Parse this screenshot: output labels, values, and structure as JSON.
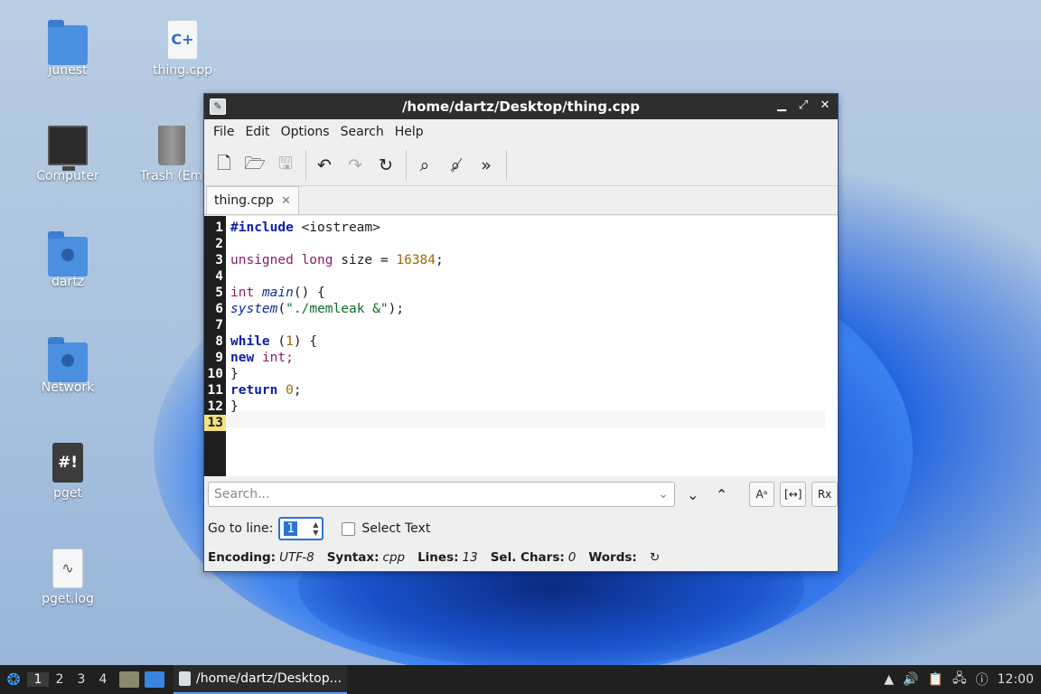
{
  "desktop": {
    "icons": [
      {
        "label": "junest"
      },
      {
        "label": "thing.cpp"
      },
      {
        "label": "Computer"
      },
      {
        "label": "Trash (Em"
      },
      {
        "label": "dartz"
      },
      {
        "label": "Network"
      },
      {
        "label": "pget"
      },
      {
        "label": "pget.log"
      }
    ]
  },
  "window": {
    "title": "/home/dartz/Desktop/thing.cpp",
    "menu": [
      "File",
      "Edit",
      "Options",
      "Search",
      "Help"
    ],
    "tab": {
      "label": "thing.cpp",
      "close": "✕"
    },
    "line_numbers": [
      "1",
      "2",
      "3",
      "4",
      "5",
      "6",
      "7",
      "8",
      "9",
      "10",
      "11",
      "12",
      "13"
    ],
    "current_line": "13",
    "code": {
      "l1a": "#include",
      "l1b": " <iostream>",
      "l3a": "unsigned long",
      "l3b": " size = ",
      "l3c": "16384",
      "l3d": ";",
      "l5a": "int",
      "l5b": " ",
      "l5c": "main",
      "l5d": "() {",
      "l6a": "system",
      "l6b": "(",
      "l6c": "\"./memleak &\"",
      "l6d": ");",
      "l8a": "while",
      "l8b": " (",
      "l8c": "1",
      "l8d": ") {",
      "l9a": "new",
      "l9b": " ",
      "l9c": "int;",
      "l10": "}",
      "l11a": "return",
      "l11b": " ",
      "l11c": "0",
      "l11d": ";",
      "l12": "}"
    },
    "search": {
      "placeholder": "Search...",
      "btn_case": "Aᵃ",
      "btn_whole": "[↔]",
      "btn_regex": "Rx"
    },
    "goto": {
      "label": "Go to line:",
      "value": "1",
      "select_text": "Select Text"
    },
    "status": {
      "encoding_label": "Encoding:",
      "encoding": "UTF-8",
      "syntax_label": "Syntax:",
      "syntax": "cpp",
      "lines_label": "Lines:",
      "lines": "13",
      "selchars_label": "Sel. Chars:",
      "selchars": "0",
      "words_label": "Words:"
    }
  },
  "taskbar": {
    "workspaces": [
      "1",
      "2",
      "3",
      "4"
    ],
    "task_label": "/home/dartz/Desktop...",
    "clock": "12:00"
  }
}
